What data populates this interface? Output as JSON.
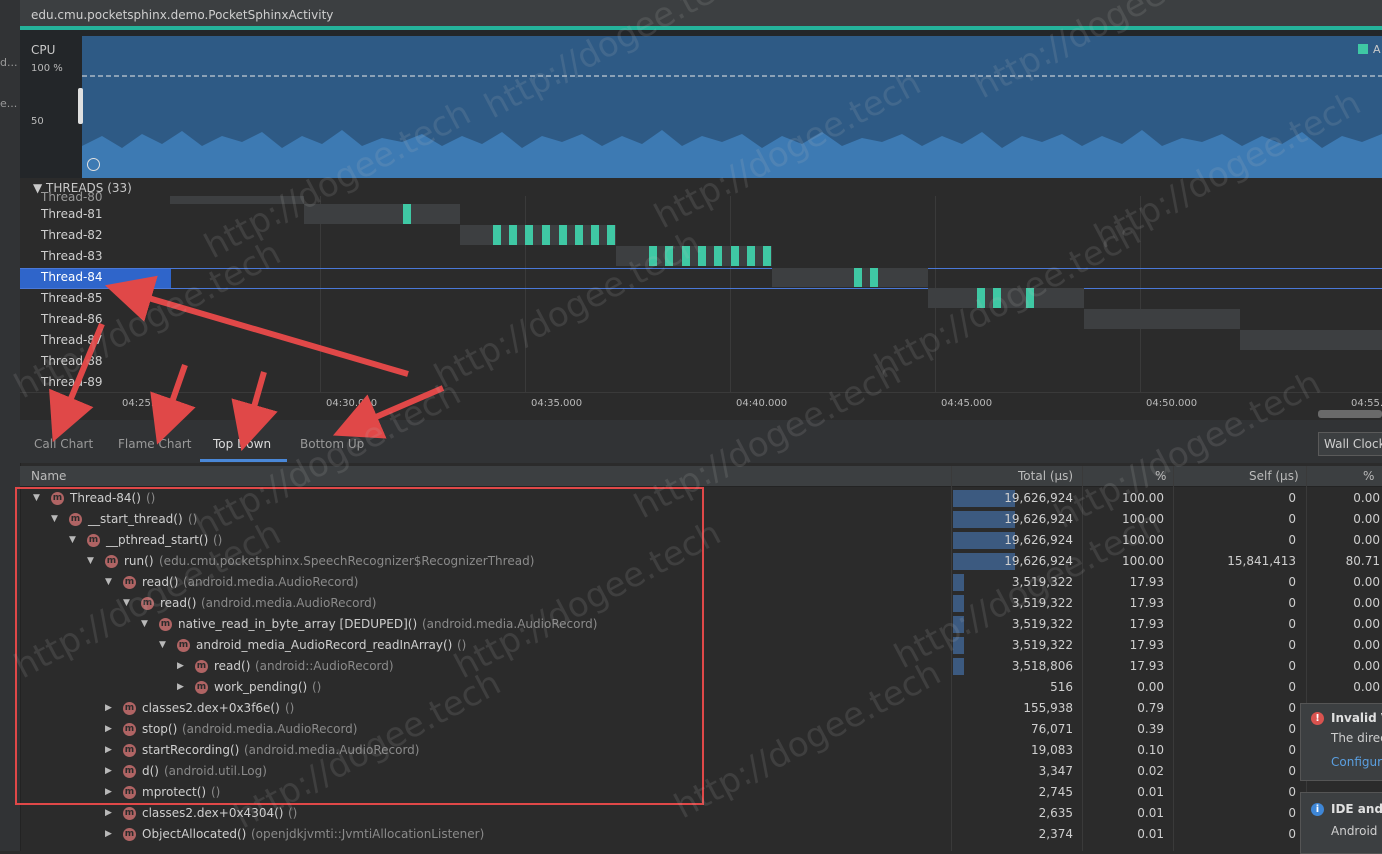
{
  "window": {
    "title": "edu.cmu.pocketsphinx.demo.PocketSphinxActivity"
  },
  "left_strip": {
    "text1": "d...",
    "text2": "e..."
  },
  "cpu": {
    "label": "CPU",
    "max_label": "100 %",
    "mid_label": "50",
    "legend_label": "A"
  },
  "threads": {
    "header": "THREADS (33)",
    "items": [
      {
        "name": "Thread-80"
      },
      {
        "name": "Thread-81"
      },
      {
        "name": "Thread-82"
      },
      {
        "name": "Thread-83"
      },
      {
        "name": "Thread-84"
      },
      {
        "name": "Thread-85"
      },
      {
        "name": "Thread-86"
      },
      {
        "name": "Thread-87"
      },
      {
        "name": "Thread-88"
      },
      {
        "name": "Thread-89"
      }
    ],
    "selected": "Thread-84"
  },
  "timeline": {
    "ticks": [
      "04:25.000",
      "04:30.000",
      "04:35.000",
      "04:40.000",
      "04:45.000",
      "04:50.000",
      "04:55.0"
    ]
  },
  "tabs": [
    {
      "label": "Call Chart"
    },
    {
      "label": "Flame Chart"
    },
    {
      "label": "Top Down"
    },
    {
      "label": "Bottom Up"
    }
  ],
  "active_tab": "Top Down",
  "clock_select": {
    "value": "Wall Clock"
  },
  "table": {
    "columns": [
      "Name",
      "Total (μs)",
      "%",
      "Self (μs)",
      "%"
    ],
    "rows": [
      {
        "expander": "▼",
        "name": "Thread-84()",
        "pkg": "()",
        "total": "19,626,924",
        "pct": "100.00",
        "self": "0",
        "self_pct": "0.00",
        "share": 1.0
      },
      {
        "expander": "▼",
        "name": "__start_thread()",
        "pkg": "()",
        "total": "19,626,924",
        "pct": "100.00",
        "self": "0",
        "self_pct": "0.00",
        "share": 1.0
      },
      {
        "expander": "▼",
        "name": "__pthread_start()",
        "pkg": "()",
        "total": "19,626,924",
        "pct": "100.00",
        "self": "0",
        "self_pct": "0.00",
        "share": 1.0
      },
      {
        "expander": "▼",
        "name": "run()",
        "pkg": "(edu.cmu.pocketsphinx.SpeechRecognizer$RecognizerThread)",
        "total": "19,626,924",
        "pct": "100.00",
        "self": "15,841,413",
        "self_pct": "80.71",
        "share": 1.0
      },
      {
        "expander": "▼",
        "name": "read()",
        "pkg": "(android.media.AudioRecord)",
        "total": "3,519,322",
        "pct": "17.93",
        "self": "0",
        "self_pct": "0.00",
        "share": 0.1793
      },
      {
        "expander": "▼",
        "name": "read()",
        "pkg": "(android.media.AudioRecord)",
        "total": "3,519,322",
        "pct": "17.93",
        "self": "0",
        "self_pct": "0.00",
        "share": 0.1793
      },
      {
        "expander": "▼",
        "name": "native_read_in_byte_array [DEDUPED]()",
        "pkg": "(android.media.AudioRecord)",
        "total": "3,519,322",
        "pct": "17.93",
        "self": "0",
        "self_pct": "0.00",
        "share": 0.1793
      },
      {
        "expander": "▼",
        "name": "android_media_AudioRecord_readInArray()",
        "pkg": "()",
        "total": "3,519,322",
        "pct": "17.93",
        "self": "0",
        "self_pct": "0.00",
        "share": 0.1793
      },
      {
        "expander": "▶",
        "name": "read()",
        "pkg": "(android::AudioRecord)",
        "total": "3,518,806",
        "pct": "17.93",
        "self": "0",
        "self_pct": "0.00",
        "share": 0.1793
      },
      {
        "expander": "▶",
        "name": "work_pending()",
        "pkg": "()",
        "total": "516",
        "pct": "0.00",
        "self": "0",
        "self_pct": "0.00",
        "share": 0.0
      },
      {
        "expander": "▶",
        "name": "classes2.dex+0x3f6e()",
        "pkg": "()",
        "total": "155,938",
        "pct": "0.79",
        "self": "0",
        "self_pct": "",
        "share": 0.0
      },
      {
        "expander": "▶",
        "name": "stop()",
        "pkg": "(android.media.AudioRecord)",
        "total": "76,071",
        "pct": "0.39",
        "self": "0",
        "self_pct": "",
        "share": 0.0
      },
      {
        "expander": "▶",
        "name": "startRecording()",
        "pkg": "(android.media.AudioRecord)",
        "total": "19,083",
        "pct": "0.10",
        "self": "0",
        "self_pct": "",
        "share": 0.0
      },
      {
        "expander": "▶",
        "name": "d()",
        "pkg": "(android.util.Log)",
        "total": "3,347",
        "pct": "0.02",
        "self": "0",
        "self_pct": "",
        "share": 0.0
      },
      {
        "expander": "▶",
        "name": "mprotect()",
        "pkg": "()",
        "total": "2,745",
        "pct": "0.01",
        "self": "0",
        "self_pct": "",
        "share": 0.0
      },
      {
        "expander": "▶",
        "name": "classes2.dex+0x4304()",
        "pkg": "()",
        "total": "2,635",
        "pct": "0.01",
        "self": "0",
        "self_pct": "",
        "share": 0.0
      },
      {
        "expander": "▶",
        "name": "ObjectAllocated()",
        "pkg": "(openjdkjvmti::JvmtiAllocationListener)",
        "total": "2,374",
        "pct": "0.01",
        "self": "0",
        "self_pct": "",
        "share": 0.0
      }
    ]
  },
  "notifications": [
    {
      "title": "Invalid V",
      "text": "The direc",
      "link": "Configur"
    },
    {
      "title": "IDE and",
      "text": "Android"
    }
  ],
  "watermark": "http://dogee.tech",
  "colors": {
    "accent": "#25b39b",
    "selection": "#2f65ca",
    "thread_active": "#3fc8a4",
    "annotation_red": "#e04848",
    "cpu_fill": "#2e5a85"
  }
}
